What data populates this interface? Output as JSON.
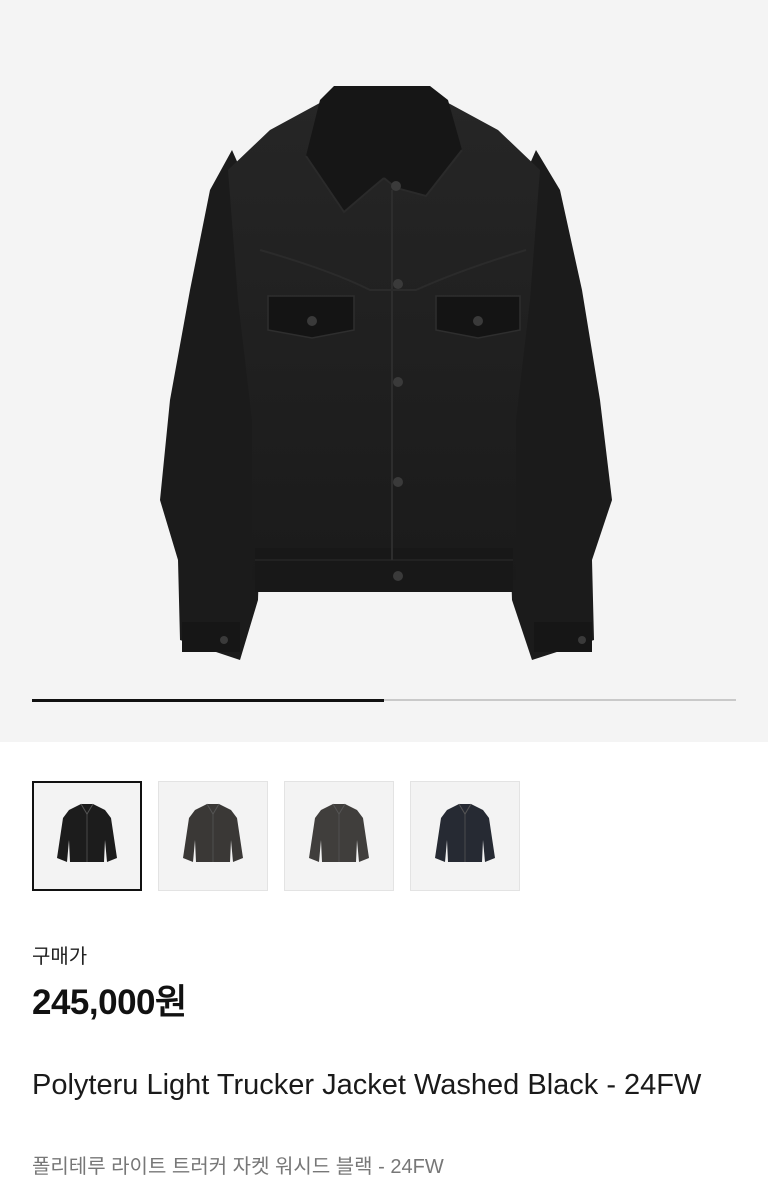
{
  "product": {
    "image_alt": "Black trucker jacket",
    "gallery_progress": 0.5,
    "thumbnails": [
      {
        "name": "thumbnail-black",
        "color": "#1c1c1c",
        "selected": true
      },
      {
        "name": "thumbnail-washed-black",
        "color": "#3a3836",
        "selected": false
      },
      {
        "name": "thumbnail-charcoal",
        "color": "#403e3c",
        "selected": false
      },
      {
        "name": "thumbnail-navy",
        "color": "#262a33",
        "selected": false
      }
    ],
    "price_label": "구매가",
    "price": "245,000원",
    "title": "Polyteru Light Trucker Jacket Washed Black - 24FW",
    "subtitle": "폴리테루 라이트 트러커 자켓 워시드 블랙 - 24FW"
  },
  "colors": {
    "jacket_main": "#1e1e1e",
    "hero_background": "#f4f4f4"
  }
}
